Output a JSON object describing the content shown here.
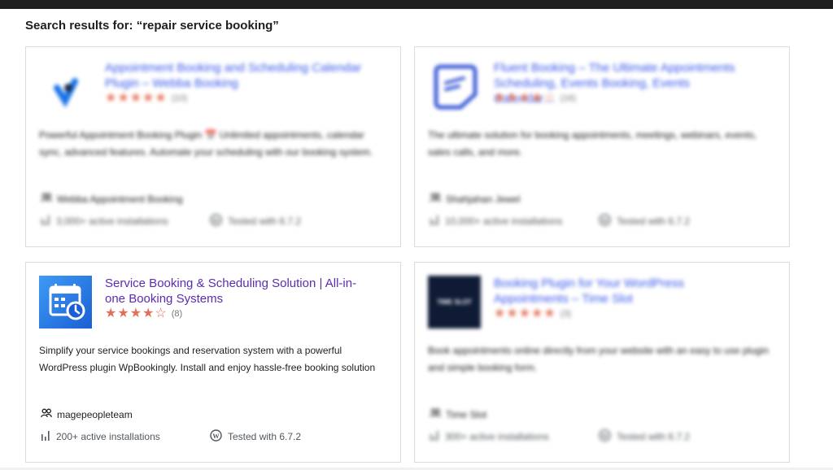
{
  "search": {
    "title": "Search results for: “repair service booking”"
  },
  "plugins": [
    {
      "title": "Appointment Booking and Scheduling Calendar Plugin – Webba Booking",
      "rating": 5,
      "rating_count": "(10)",
      "description": "Powerful Appointment Booking Plugin 📅 Unlimited appointments, calendar sync, advanced features. Automate your scheduling with our booking system.",
      "author": "Webba Appointment Booking",
      "installs": "3,000+ active installations",
      "tested": "Tested with 6.7.2",
      "thumb_color": "#1a73e8"
    },
    {
      "title": "Fluent Booking – The Ultimate Appointments Scheduling, Events Booking, Events Calendar…",
      "rating": 4.5,
      "rating_count": "(16)",
      "description": "The ultimate solution for booking appointments, meetings, webinars, events, sales calls, and more.",
      "author": "Shahjahan Jewel",
      "installs": "10,000+ active installations",
      "tested": "Tested with 6.7.2",
      "thumb_color": "#3c5bd6"
    },
    {
      "title": "Service Booking & Scheduling Solution | All-in-one Booking Systems",
      "rating": 4,
      "rating_count": "(8)",
      "description": "Simplify your service bookings and reservation system with a powerful WordPress plugin WpBookingly. Install and enjoy hassle-free booking solution",
      "author": "magepeopleteam",
      "installs": "200+ active installations",
      "tested": "Tested with 6.7.2",
      "thumb_color": "#2e7ee6"
    },
    {
      "title": "Booking Plugin for Your WordPress Appointments – Time Slot",
      "rating": 5,
      "rating_count": "(3)",
      "description": "Book appointments online directly from your website with an easy to use plugin and simple booking form.",
      "author": "Time Slot",
      "installs": "300+ active installations",
      "tested": "Tested with 6.7.2",
      "thumb_text": "TIME SLOT",
      "thumb_color": "#0f1b35"
    }
  ],
  "colors": {
    "link": "#3858e9",
    "star": "#e26f56",
    "visited_title": "#5b2bb0"
  }
}
